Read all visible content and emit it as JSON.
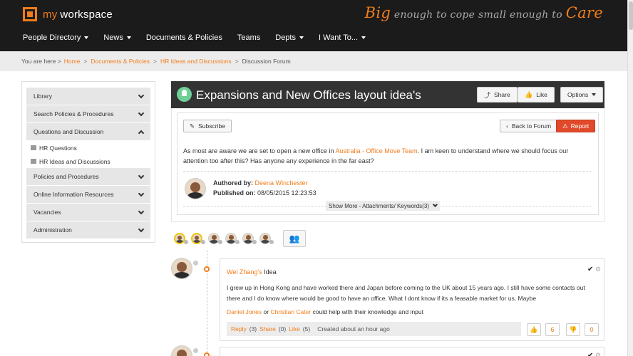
{
  "brand": {
    "prefix": "my",
    "name": "workspace"
  },
  "tagline": {
    "big": "Big",
    "mid": "enough to cope small enough to",
    "care": "Care"
  },
  "nav": [
    {
      "label": "People Directory",
      "dropdown": true
    },
    {
      "label": "News",
      "dropdown": true
    },
    {
      "label": "Documents & Policies",
      "dropdown": false
    },
    {
      "label": "Teams",
      "dropdown": false
    },
    {
      "label": "Depts",
      "dropdown": true
    },
    {
      "label": "I Want To...",
      "dropdown": true
    }
  ],
  "breadcrumb": {
    "prefix": "You are here >",
    "items": [
      "Home",
      "Documents & Policies",
      "HR Ideas and Discussions",
      "Discussion Forum"
    ]
  },
  "sidebar": {
    "items": [
      {
        "label": "Library"
      },
      {
        "label": "Search Policies & Procedures"
      },
      {
        "label": "Questions and Discussion"
      },
      {
        "label": "Policies and Procedures"
      },
      {
        "label": "Online Information Resources"
      },
      {
        "label": "Vacancies"
      },
      {
        "label": "Administration"
      }
    ],
    "subitems": [
      "HR Questions",
      "HR Ideas and Discussions"
    ]
  },
  "post": {
    "title": "Expansions and New Offices layout idea's",
    "share_label": "Share",
    "like_label": "Like",
    "options_label": "Options",
    "subscribe_label": "Subscribe",
    "back_label": "Back to Forum",
    "report_label": "Report",
    "text_before": "As most are aware we are set to open a new office in ",
    "text_link": "Australia - Office Move Team",
    "text_after": ". I am keen to understand where we should focus our attention too after this? Has anyone any experience in the far east?",
    "authored_label": "Authored by:",
    "author": "Deena Winchester",
    "published_label": "Published on:",
    "published": "08/05/2015 12:23:53",
    "show_more": "Show More - Attachments/ Keywords(3)"
  },
  "reply": {
    "author": "Wei Zhang's",
    "type": "Idea",
    "body": "I grew up in Hong Kong and have worked there and Japan before coming to the UK about 15 years ago. I still have some contacts out there and I do know where would be good to have an office. What I dont know if its a feasable  market for us. Maybe",
    "mention_1": "Daniel Jones",
    "mention_or": "or",
    "mention_2": "Christian Cater",
    "mention_tail": "could help with their knowledge and input",
    "reply_label": "Reply",
    "reply_count": "(3)",
    "share_label": "Share",
    "share_count": "(0)",
    "like_label": "Like",
    "like_count": "(5)",
    "created": "Created about an hour ago",
    "up_votes": "6",
    "down_votes": "0"
  },
  "colors": {
    "accent": "#f07d1a",
    "header_bg": "#1b1b1b",
    "title_bar": "#333333",
    "report": "#e04a2a"
  }
}
